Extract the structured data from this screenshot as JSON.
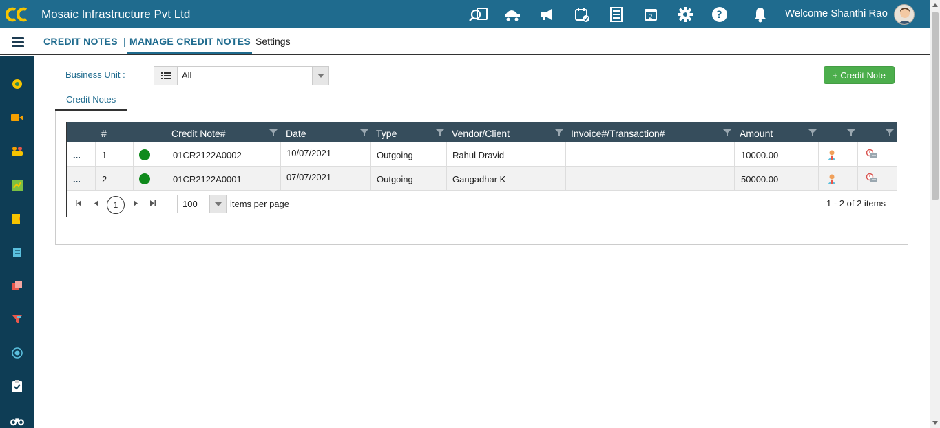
{
  "header": {
    "company": "Mosaic Infrastructure Pvt Ltd",
    "welcome": "Welcome Shanthi Rao",
    "icons": [
      "search-doc-icon",
      "truck-icon",
      "megaphone-icon",
      "calendar-check-icon",
      "list-doc-icon",
      "calendar-icon",
      "gear-icon",
      "help-icon"
    ]
  },
  "nav": {
    "credit_notes": "CREDIT NOTES",
    "separator": "|",
    "manage": "MANAGE CREDIT NOTES",
    "settings": "Settings"
  },
  "sidebar": {
    "icons": [
      "dashboard-icon",
      "video-icon",
      "users-icon",
      "chart-icon",
      "document-icon",
      "book-icon",
      "files-icon",
      "filter-icon",
      "target-icon",
      "clipboard-icon",
      "binoculars-icon"
    ]
  },
  "filters": {
    "business_unit_label": "Business Unit :",
    "business_unit_value": "All"
  },
  "actions": {
    "add_credit_note": "+ Credit Note"
  },
  "tabs": {
    "active": "Credit Notes"
  },
  "grid": {
    "columns": [
      "#",
      "Credit Note#",
      "Date",
      "Type",
      "Vendor/Client",
      "Invoice#/Transaction#",
      "Amount"
    ],
    "rows": [
      {
        "menu": "...",
        "num": "1",
        "credit_note": "01CR2122A0002",
        "date": "10/07/2021",
        "type": "Outgoing",
        "party": "Rahul Dravid",
        "invoice": "",
        "amount": "10000.00"
      },
      {
        "menu": "...",
        "num": "2",
        "credit_note": "01CR2122A0001",
        "date": "07/07/2021",
        "type": "Outgoing",
        "party": "Gangadhar K",
        "invoice": "",
        "amount": "50000.00"
      }
    ],
    "status_color": "#0f8a1c"
  },
  "pager": {
    "current_page": "1",
    "page_size": "100",
    "items_per_page_label": "items per page",
    "info": "1 - 2 of 2 items"
  },
  "colors": {
    "header_bg": "#1f6b8e",
    "sidebar_bg": "#0e3d55",
    "grid_header_bg": "#364d5c",
    "add_button": "#4cae4c"
  }
}
